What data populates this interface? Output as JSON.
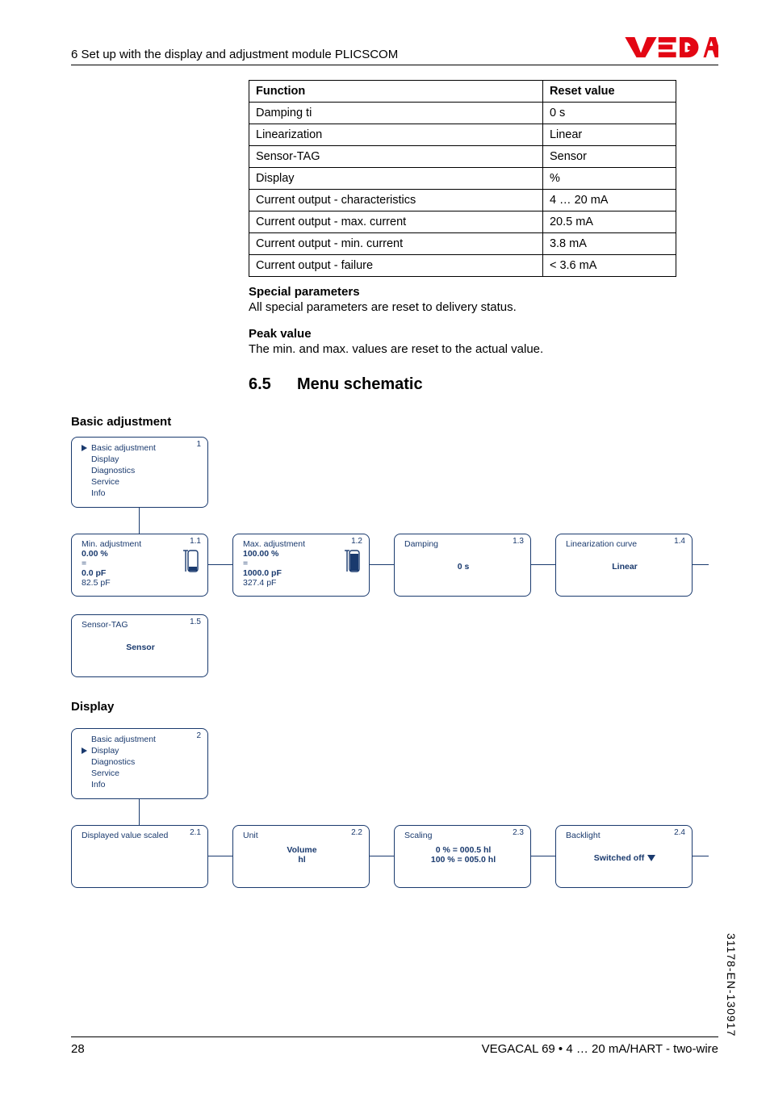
{
  "header": {
    "section_line": "6 Set up with the display and adjustment module PLICSCOM",
    "logo_text": "VEGA"
  },
  "reset_table": {
    "headers": [
      "Function",
      "Reset value"
    ],
    "rows": [
      [
        "Damping ti",
        "0 s"
      ],
      [
        "Linearization",
        "Linear"
      ],
      [
        "Sensor-TAG",
        "Sensor"
      ],
      [
        "Display",
        "%"
      ],
      [
        "Current output - characteristics",
        "4 … 20 mA"
      ],
      [
        "Current output - max. current",
        "20.5 mA"
      ],
      [
        "Current output - min. current",
        "3.8 mA"
      ],
      [
        "Current output - failure",
        "< 3.6 mA"
      ]
    ]
  },
  "special": {
    "heading": "Special parameters",
    "text": "All special parameters are reset to delivery status."
  },
  "peak": {
    "heading": "Peak value",
    "text": "The min. and max. values are reset to the actual value."
  },
  "chapter": {
    "num": "6.5",
    "title": "Menu schematic"
  },
  "basic_adjustment": {
    "label": "Basic adjustment",
    "menu_num": "1",
    "menu_items": [
      "Basic adjustment",
      "Display",
      "Diagnostics",
      "Service",
      "Info"
    ],
    "selected_index": 0,
    "boxes": {
      "min_adj": {
        "num": "1.1",
        "title": "Min. adjustment",
        "line1": "0.00 %",
        "line2": "=",
        "line3": "0.0 pF",
        "line4": "82.5 pF"
      },
      "max_adj": {
        "num": "1.2",
        "title": "Max. adjustment",
        "line1": "100.00 %",
        "line2": "=",
        "line3": "1000.0 pF",
        "line4": "327.4 pF"
      },
      "damping": {
        "num": "1.3",
        "title": "Damping",
        "value": "0 s"
      },
      "lin_curve": {
        "num": "1.4",
        "title": "Linearization curve",
        "value": "Linear"
      },
      "sensor_tag": {
        "num": "1.5",
        "title": "Sensor-TAG",
        "value": "Sensor"
      }
    }
  },
  "display_section": {
    "label": "Display",
    "menu_num": "2",
    "menu_items": [
      "Basic adjustment",
      "Display",
      "Diagnostics",
      "Service",
      "Info"
    ],
    "selected_index": 1,
    "boxes": {
      "disp_scaled": {
        "num": "2.1",
        "title": "Displayed value scaled"
      },
      "unit": {
        "num": "2.2",
        "title": "Unit",
        "line1": "Volume",
        "line2": "hl"
      },
      "scaling": {
        "num": "2.3",
        "title": "Scaling",
        "line1": "0 % = 000.5 hl",
        "line2": "100 % = 005.0 hl"
      },
      "backlight": {
        "num": "2.4",
        "title": "Backlight",
        "value": "Switched off"
      }
    }
  },
  "footer": {
    "page": "28",
    "product": "VEGACAL 69 • 4 … 20 mA/HART - two-wire",
    "side_code": "31178-EN-130917"
  }
}
